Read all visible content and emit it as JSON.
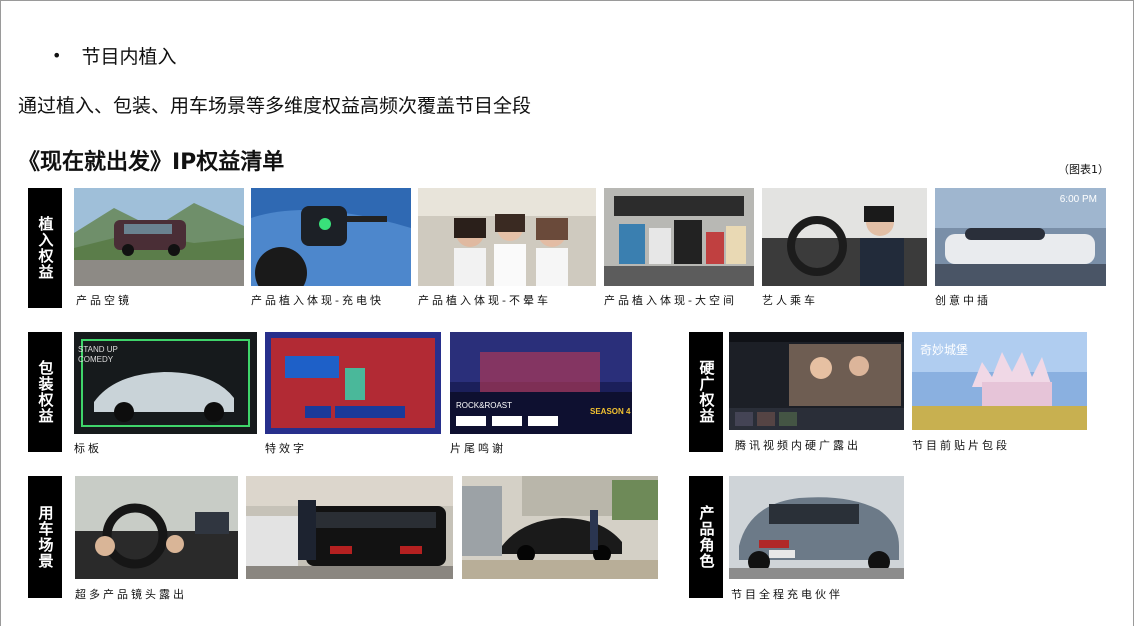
{
  "bullet": {
    "marker": "•",
    "text": "节目内植入"
  },
  "subtitle": "通过植入、包装、用车场景等多维度权益高频次覆盖节目全段",
  "heading": "《现在就出发》IP权益清单",
  "figure_label": "（图表1）",
  "categories": {
    "placement": "植入权益",
    "packaging": "包装权益",
    "hard_ads": "硬广权益",
    "scene": "用车场景",
    "role": "产品角色"
  },
  "captions": {
    "p1": "产品空镜",
    "p2": "产品植入体现-充电快",
    "p3": "产品植入体现-不晕车",
    "p4": "产品植入体现-大空间",
    "p5": "艺人乘车",
    "p6": "创意中插",
    "k1": "标板",
    "k2": "特效字",
    "k3": "片尾鸣谢",
    "h1": "腾讯视频内硬广露出",
    "h2": "节目前贴片包段",
    "s1": "超多产品镜头露出",
    "r1": "节目全程充电伙伴"
  },
  "overlays": {
    "time": "6:00 PM",
    "stand": "STAND UP",
    "comedy": "COMEDY",
    "rock": "ROCK",
    "roast": "ROAST",
    "season": "SEASON 4",
    "rockroast": "ROCK&ROAST",
    "castle": "奇妙城堡"
  }
}
